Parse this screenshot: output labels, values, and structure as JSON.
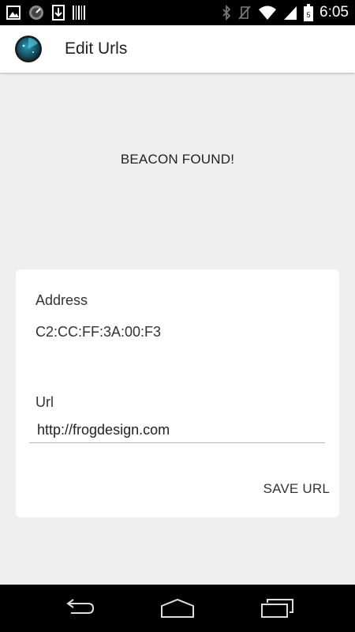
{
  "status_bar": {
    "time": "6:05",
    "left_icons": [
      "image-icon",
      "gauge-icon",
      "download-icon",
      "barcode-icon"
    ],
    "right_icons": [
      "bluetooth-icon",
      "vibrate-off-icon",
      "wifi-icon",
      "cell-signal-icon",
      "battery-icon"
    ]
  },
  "action_bar": {
    "title": "Edit Urls",
    "icon": "radar-app-icon"
  },
  "beacon": {
    "status": "BEACON FOUND!"
  },
  "card": {
    "address_label": "Address",
    "address_value": "C2:CC:FF:3A:00:F3",
    "url_label": "Url",
    "url_value": "http://frogdesign.com",
    "save_label": "SAVE URL"
  },
  "nav_bar": {
    "icons": [
      "back-icon",
      "home-icon",
      "recents-icon"
    ]
  },
  "colors": {
    "background": "#efefef",
    "card": "#ffffff",
    "bars": "#000000",
    "text": "#222222"
  }
}
